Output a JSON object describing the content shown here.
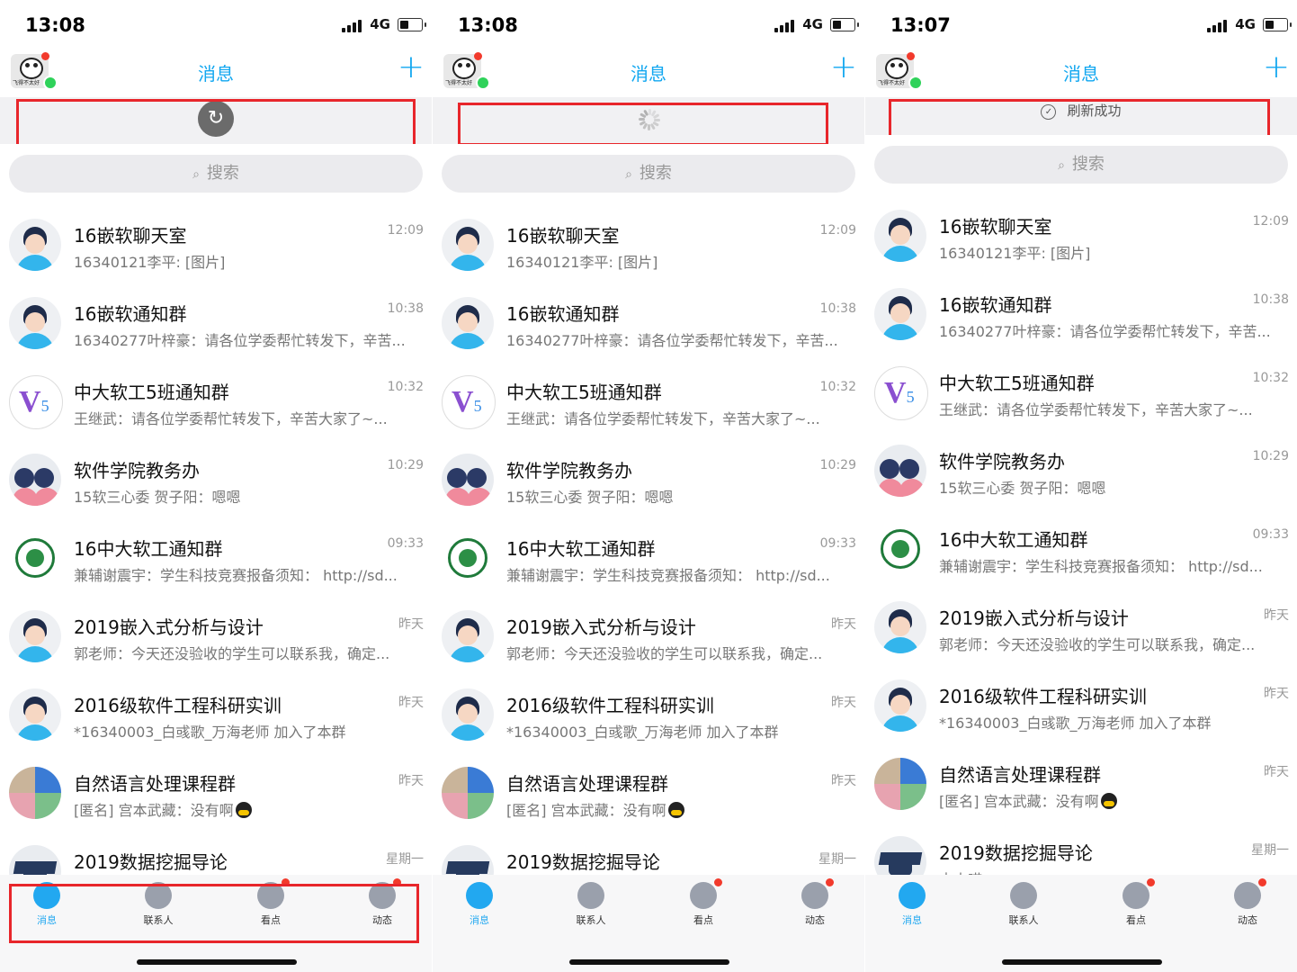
{
  "screens": [
    {
      "time": "13:08",
      "network": "4G",
      "header_title": "消息",
      "refresh_state": "pull",
      "refresh_text": "",
      "search_placeholder": "搜索",
      "tabs": [
        "消息",
        "联系人",
        "看点",
        "动态"
      ]
    },
    {
      "time": "13:08",
      "network": "4G",
      "header_title": "消息",
      "refresh_state": "loading",
      "refresh_text": "",
      "search_placeholder": "搜索",
      "tabs": [
        "消息",
        "联系人",
        "看点",
        "动态"
      ]
    },
    {
      "time": "13:07",
      "network": "4G",
      "header_title": "消息",
      "refresh_state": "success",
      "refresh_text": "刷新成功",
      "search_placeholder": "搜索",
      "tabs": [
        "消息",
        "联系人",
        "看点",
        "动态"
      ]
    }
  ],
  "conversations": [
    {
      "name": "16嵌软聊天室",
      "message": "16340121李平: [图片]",
      "time": "12:09",
      "avatar": "person"
    },
    {
      "name": "16嵌软通知群",
      "message": "16340277叶梓豪：请各位学委帮忙转发下，辛苦...",
      "time": "10:38",
      "avatar": "person"
    },
    {
      "name": "中大软工5班通知群",
      "message": "王继武：请各位学委帮忙转发下，辛苦大家了~...",
      "time": "10:32",
      "avatar": "v5"
    },
    {
      "name": "软件学院教务办",
      "message": "15软三心委 贺子阳：嗯嗯",
      "time": "10:29",
      "avatar": "couple"
    },
    {
      "name": "16中大软工通知群",
      "message": "兼辅谢震宇：学生科技竞赛报备须知：    http://sd...",
      "time": "09:33",
      "avatar": "seal"
    },
    {
      "name": "2019嵌入式分析与设计",
      "message": "郭老师：今天还没验收的学生可以联系我，确定...",
      "time": "昨天",
      "avatar": "person"
    },
    {
      "name": "2016级软件工程科研实训",
      "message": "*16340003_白彧歌_万海老师 加入了本群",
      "time": "昨天",
      "avatar": "person"
    },
    {
      "name": "自然语言处理课程群",
      "message": "[匿名] 宫本武藏：没有啊",
      "time": "昨天",
      "avatar": "mosaic"
    },
    {
      "name": "2019数据挖掘导论",
      "message": "中大喵：",
      "time": "星期一",
      "avatar": "grad"
    }
  ],
  "icons": {
    "avatar_online": "online-dot",
    "add": "plus-icon",
    "refresh": "refresh-icon",
    "spinner": "loading-spinner-icon",
    "success": "check-circle-icon",
    "search": "search-icon"
  },
  "colors": {
    "accent": "#12a7f0",
    "highlight": "#e8262b",
    "badge": "#f23a2c",
    "online": "#2fd25a"
  }
}
